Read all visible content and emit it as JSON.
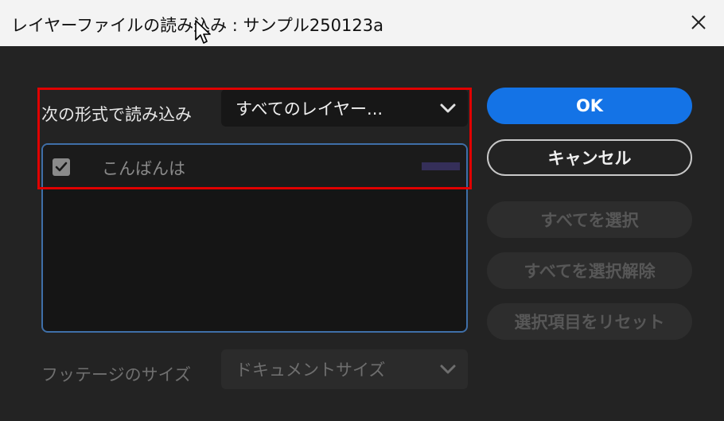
{
  "window": {
    "title": "レイヤーファイルの読み込み : サンプル250123a"
  },
  "import_as": {
    "label": "次の形式で読み込み",
    "selected": "すべてのレイヤー..."
  },
  "layers": [
    {
      "name": "こんばんは",
      "checked": true
    }
  ],
  "footage_size": {
    "label": "フッテージのサイズ",
    "selected": "ドキュメントサイズ"
  },
  "buttons": {
    "ok": "OK",
    "cancel": "キャンセル",
    "select_all": "すべてを選択",
    "deselect_all": "すべてを選択解除",
    "reset_selection": "選択項目をリセット"
  },
  "colors": {
    "accent": "#1473e6",
    "highlight": "#e00000",
    "list_border": "#3f6fa8"
  }
}
